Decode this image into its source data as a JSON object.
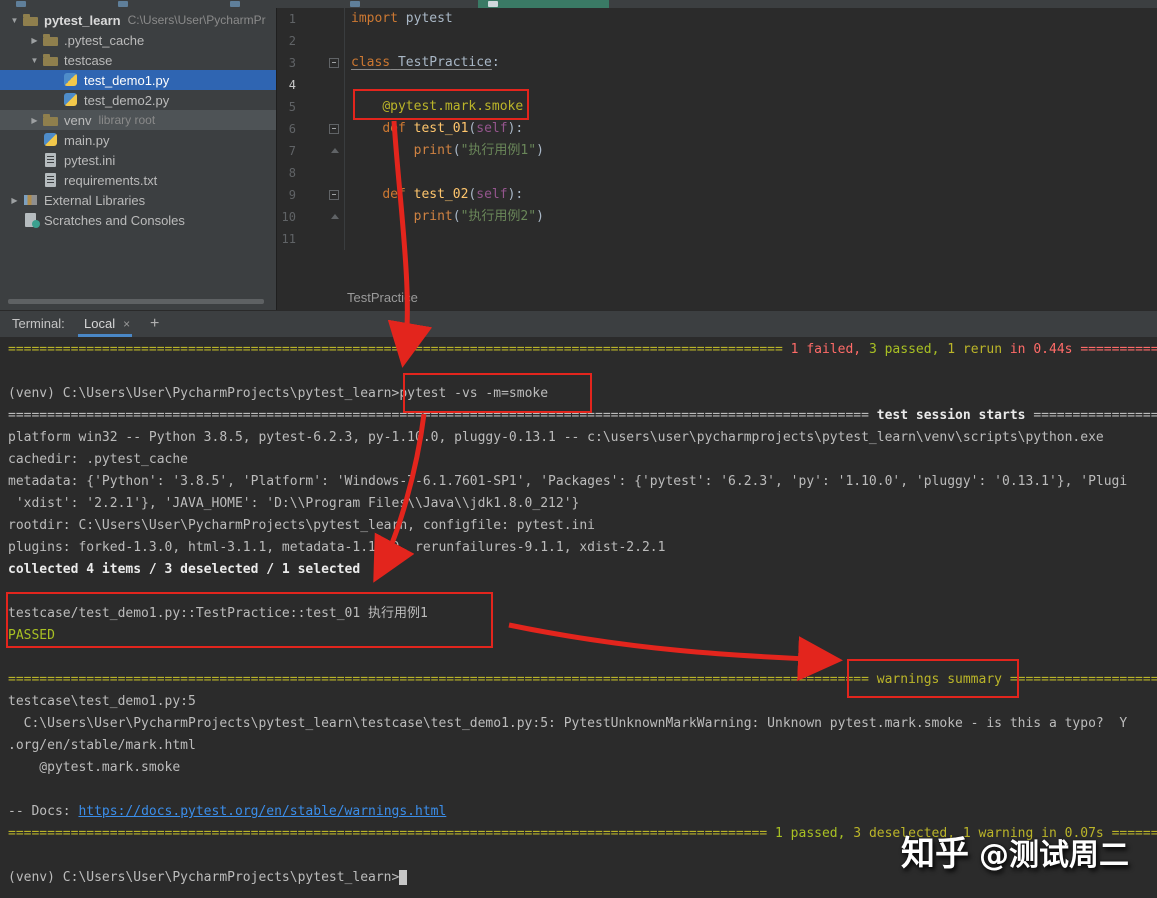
{
  "colors": {
    "panel_bg": "#3c3f41",
    "editor_bg": "#2b2b2b",
    "selection_blue": "#2f65b2",
    "tab_underline_blue": "#4a88c7",
    "annotation_red": "#e3251d",
    "terminal_red": "#ff6b68",
    "terminal_green": "#a8c023",
    "terminal_yellow": "#bbb529",
    "link_blue": "#3b8eea"
  },
  "project_tree": {
    "items": [
      {
        "id": "pytest_learn",
        "label": "pytest_learn",
        "hint": "C:\\Users\\User\\PycharmPr",
        "icon": "folder",
        "arrow": "down",
        "indent": 0,
        "bold": true
      },
      {
        "id": "pytest_cache",
        "label": ".pytest_cache",
        "icon": "folder",
        "arrow": "right",
        "indent": 1
      },
      {
        "id": "testcase",
        "label": "testcase",
        "icon": "folder",
        "arrow": "down",
        "indent": 1
      },
      {
        "id": "test_demo1",
        "label": "test_demo1.py",
        "icon": "python",
        "indent": 2,
        "selected": true
      },
      {
        "id": "test_demo2",
        "label": "test_demo2.py",
        "icon": "python",
        "indent": 2
      },
      {
        "id": "venv",
        "label": "venv",
        "hint": "library root",
        "icon": "folder",
        "arrow": "right",
        "indent": 1,
        "highlighted": true
      },
      {
        "id": "main_py",
        "label": "main.py",
        "icon": "python",
        "indent": 1
      },
      {
        "id": "pytest_ini",
        "label": "pytest.ini",
        "icon": "ini",
        "indent": 1
      },
      {
        "id": "requirements_txt",
        "label": "requirements.txt",
        "icon": "txt",
        "indent": 1
      },
      {
        "id": "external_libraries",
        "label": "External Libraries",
        "icon": "libs",
        "arrow": "right",
        "indent": 0
      },
      {
        "id": "scratches",
        "label": "Scratches and Consoles",
        "icon": "scratch",
        "indent": 0
      }
    ]
  },
  "editor": {
    "breadcrumb": "TestPractice",
    "lines": [
      {
        "n": 1,
        "segs": [
          {
            "t": "import",
            "s": "kw"
          },
          {
            "t": " pytest",
            "s": "def"
          }
        ]
      },
      {
        "n": 2,
        "segs": []
      },
      {
        "n": 3,
        "fold": "minus",
        "segs": [
          {
            "t": "class",
            "s": "kw und"
          },
          {
            "t": " ",
            "s": "und"
          },
          {
            "t": "TestPractice",
            "s": "def und"
          },
          {
            "t": ":",
            "s": "def"
          }
        ]
      },
      {
        "n": 4,
        "current": true,
        "segs": []
      },
      {
        "n": 5,
        "segs": [
          {
            "t": "    ",
            "s": "def"
          },
          {
            "t": "@pytest.mark.smoke",
            "s": "dec"
          }
        ]
      },
      {
        "n": 6,
        "fold": "minus",
        "segs": [
          {
            "t": "    ",
            "s": "def"
          },
          {
            "t": "def",
            "s": "kw"
          },
          {
            "t": " ",
            "s": "def"
          },
          {
            "t": "test_01",
            "s": "fn"
          },
          {
            "t": "(",
            "s": "def"
          },
          {
            "t": "self",
            "s": "slf"
          },
          {
            "t": "):",
            "s": "def"
          }
        ]
      },
      {
        "n": 7,
        "fold": "end",
        "segs": [
          {
            "t": "        ",
            "s": "def"
          },
          {
            "t": "print",
            "s": "bi"
          },
          {
            "t": "(",
            "s": "def"
          },
          {
            "t": "\"执行用例1\"",
            "s": "str"
          },
          {
            "t": ")",
            "s": "def"
          }
        ]
      },
      {
        "n": 8,
        "segs": []
      },
      {
        "n": 9,
        "fold": "minus",
        "segs": [
          {
            "t": "    ",
            "s": "def"
          },
          {
            "t": "def",
            "s": "kw"
          },
          {
            "t": " ",
            "s": "def"
          },
          {
            "t": "test_02",
            "s": "fn"
          },
          {
            "t": "(",
            "s": "def"
          },
          {
            "t": "self",
            "s": "slf"
          },
          {
            "t": "):",
            "s": "def"
          }
        ]
      },
      {
        "n": 10,
        "fold": "end",
        "segs": [
          {
            "t": "        ",
            "s": "def"
          },
          {
            "t": "print",
            "s": "bi"
          },
          {
            "t": "(",
            "s": "def"
          },
          {
            "t": "\"执行用例2\"",
            "s": "str"
          },
          {
            "t": ")",
            "s": "def"
          }
        ]
      },
      {
        "n": 11,
        "segs": []
      }
    ]
  },
  "terminal_bar": {
    "label": "Terminal:",
    "tab": "Local",
    "close": "×",
    "new_tab": "+"
  },
  "terminal": {
    "lines": [
      {
        "segs": [
          {
            "t": "=",
            "r": 99,
            "s": "yellow"
          },
          {
            "t": " 1 failed,",
            "s": "red"
          },
          {
            "t": " 3 passed,",
            "s": "green"
          },
          {
            "t": " 1 rerun",
            "s": "yellow"
          },
          {
            "t": " in 0.44s ",
            "s": "red"
          },
          {
            "t": "=",
            "r": 15,
            "s": "red"
          }
        ]
      },
      {
        "segs": []
      },
      {
        "segs": [
          {
            "t": "(venv) C:\\Users\\User\\PycharmProjects\\pytest_learn>",
            "s": "def"
          },
          {
            "t": "pytest -vs -m=smoke",
            "s": "def"
          }
        ]
      },
      {
        "segs": [
          {
            "t": "=",
            "r": 110,
            "s": "def"
          },
          {
            "t": " test session starts ",
            "s": "bold"
          },
          {
            "t": "=",
            "r": 22,
            "s": "def"
          }
        ]
      },
      {
        "segs": [
          {
            "t": "platform win32 -- Python 3.8.5, pytest-6.2.3, py-1.10.0, pluggy-0.13.1 -- c:\\users\\user\\pycharmprojects\\pytest_learn\\venv\\scripts\\python.exe",
            "s": "def"
          }
        ]
      },
      {
        "segs": [
          {
            "t": "cachedir: .pytest_cache",
            "s": "def"
          }
        ]
      },
      {
        "segs": [
          {
            "t": "metadata: {'Python': '3.8.5', 'Platform': 'Windows-7-6.1.7601-SP1', 'Packages': {'pytest': '6.2.3', 'py': '1.10.0', 'pluggy': '0.13.1'}, 'Plugi",
            "s": "def"
          }
        ]
      },
      {
        "segs": [
          {
            "t": " 'xdist': '2.2.1'}, 'JAVA_HOME': 'D:\\\\Program Files\\\\Java\\\\jdk1.8.0_212'}",
            "s": "def"
          }
        ]
      },
      {
        "segs": [
          {
            "t": "rootdir: C:\\Users\\User\\PycharmProjects\\pytest_learn, configfile: pytest.ini",
            "s": "def"
          }
        ]
      },
      {
        "segs": [
          {
            "t": "plugins: forked-1.3.0, html-3.1.1, metadata-1.11.0, rerunfailures-9.1.1, xdist-2.2.1",
            "s": "def"
          }
        ]
      },
      {
        "segs": [
          {
            "t": "collected 4 items / 3 deselected / 1 selected",
            "s": "bold"
          }
        ]
      },
      {
        "segs": []
      },
      {
        "segs": [
          {
            "t": "testcase/test_demo1.py::TestPractice::test_01 执行用例1",
            "s": "def"
          }
        ]
      },
      {
        "segs": [
          {
            "t": "PASSED",
            "s": "green"
          }
        ]
      },
      {
        "segs": []
      },
      {
        "segs": [
          {
            "t": "=",
            "r": 110,
            "s": "yellow"
          },
          {
            "t": " warnings summary ",
            "s": "yellow"
          },
          {
            "t": "=",
            "r": 25,
            "s": "yellow"
          }
        ]
      },
      {
        "segs": [
          {
            "t": "testcase\\test_demo1.py:5",
            "s": "def"
          }
        ]
      },
      {
        "segs": [
          {
            "t": "  C:\\Users\\User\\PycharmProjects\\pytest_learn\\testcase\\test_demo1.py:5: PytestUnknownMarkWarning: Unknown pytest.mark.smoke - is this a typo?  Y",
            "s": "def"
          }
        ]
      },
      {
        "segs": [
          {
            "t": ".org/en/stable/mark.html",
            "s": "def"
          }
        ]
      },
      {
        "segs": [
          {
            "t": "    @pytest.mark.smoke",
            "s": "def"
          }
        ]
      },
      {
        "segs": []
      },
      {
        "segs": [
          {
            "t": "-- Docs: ",
            "s": "def"
          },
          {
            "t": "https://docs.pytest.org/en/stable/warnings.html",
            "s": "link"
          }
        ]
      },
      {
        "segs": [
          {
            "t": "=",
            "r": 97,
            "s": "yellow"
          },
          {
            "t": " ",
            "s": "yellow"
          },
          {
            "t": "1 passed,",
            "s": "green"
          },
          {
            "t": " 3 deselected, 1 warning in 0.07s ",
            "s": "yellow"
          },
          {
            "t": "=",
            "r": 10,
            "s": "yellow"
          }
        ]
      },
      {
        "segs": []
      },
      {
        "segs": [
          {
            "t": "(venv) C:\\Users\\User\\PycharmProjects\\pytest_learn>",
            "s": "def"
          },
          {
            "t": " ",
            "s": "cursor"
          }
        ]
      }
    ]
  },
  "watermark": {
    "brand": "知乎",
    "handle": "@测试周二"
  }
}
